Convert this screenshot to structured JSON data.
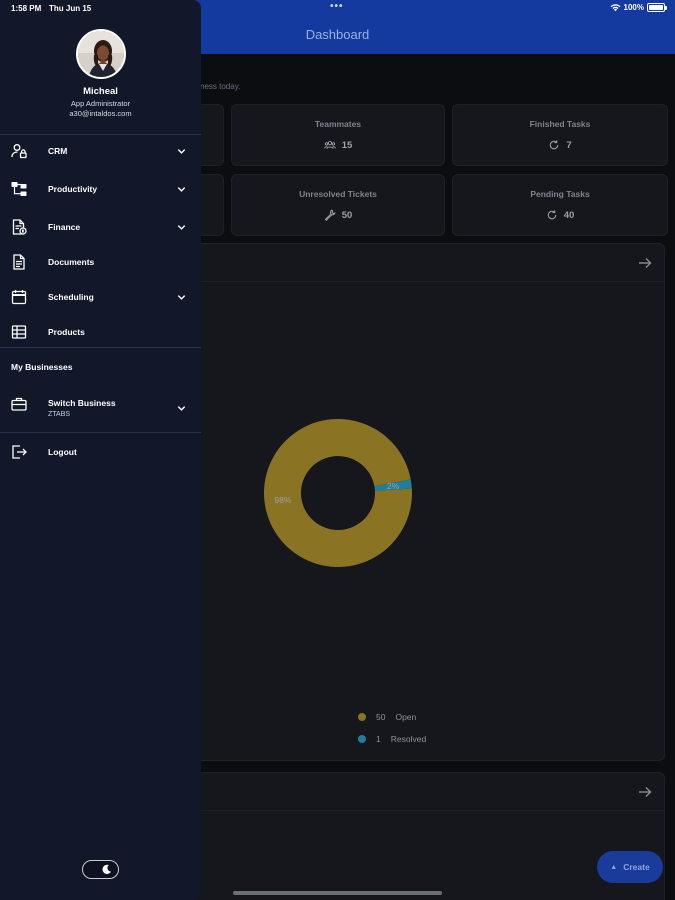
{
  "status_bar": {
    "time": "1:58 PM",
    "date": "Thu Jun 15",
    "battery": "100%"
  },
  "header": {
    "title": "Dashboard"
  },
  "dashboard": {
    "greeting": "ness today.",
    "stats": [
      {
        "title": "Teammates",
        "value": "15",
        "icon": "people-icon"
      },
      {
        "title": "Finished Tasks",
        "value": "7",
        "icon": "refresh-icon"
      },
      {
        "title": "Unresolved Tickets",
        "value": "50",
        "icon": "wrench-icon"
      },
      {
        "title": "Pending Tasks",
        "value": "40",
        "icon": "refresh-icon"
      }
    ],
    "chart_data": {
      "type": "pie",
      "title": "",
      "categories": [
        "Open",
        "Resolved"
      ],
      "values": [
        50,
        1
      ],
      "slice_labels": [
        "98%",
        "2%"
      ],
      "colors": [
        "#8a7424",
        "#1f7f9b"
      ],
      "donut": true
    },
    "legend": [
      {
        "count": "50",
        "label": "Open",
        "color": "#8a7424"
      },
      {
        "count": "1",
        "label": "Resolved",
        "color": "#1f7f9b"
      }
    ],
    "create_label": "Create"
  },
  "drawer": {
    "user": {
      "name": "Micheal",
      "role": "App Administrator",
      "email": "a30@intaldos.com"
    },
    "menu": [
      {
        "label": "CRM",
        "icon": "user-lock-icon",
        "has_children": true
      },
      {
        "label": "Productivity",
        "icon": "hierarchy-icon",
        "has_children": true
      },
      {
        "label": "Finance",
        "icon": "invoice-icon",
        "has_children": true
      },
      {
        "label": "Documents",
        "icon": "document-icon",
        "has_children": false
      },
      {
        "label": "Scheduling",
        "icon": "calendar-icon",
        "has_children": true
      },
      {
        "label": "Products",
        "icon": "table-icon",
        "has_children": false
      }
    ],
    "businesses_title": "My Businesses",
    "switch_business": {
      "label": "Switch Business",
      "current": "ZTABS"
    },
    "logout_label": "Logout"
  },
  "colors": {
    "app_bar": "#143aa0",
    "drawer_bg": "#12172a",
    "open": "#8a7424",
    "resolved": "#1f7f9b"
  }
}
